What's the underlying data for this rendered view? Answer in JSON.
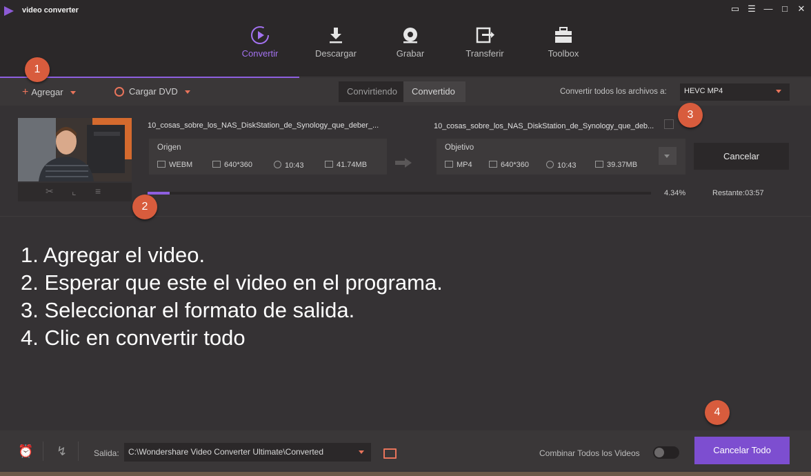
{
  "app": {
    "title": "video converter"
  },
  "nav": [
    {
      "label": "Convertir",
      "icon": "convert-icon",
      "active": true
    },
    {
      "label": "Descargar",
      "icon": "download-icon"
    },
    {
      "label": "Grabar",
      "icon": "burn-icon"
    },
    {
      "label": "Transferir",
      "icon": "transfer-icon"
    },
    {
      "label": "Toolbox",
      "icon": "toolbox-icon"
    }
  ],
  "toolbar": {
    "add_label": "Agregar",
    "dvd_label": "Cargar DVD",
    "tab_converting": "Convirtiendo",
    "tab_converted": "Convertido",
    "convert_all_label": "Convertir todos los archivos a:",
    "format": "HEVC MP4"
  },
  "file": {
    "source_name": "10_cosas_sobre_los_NAS_DiskStation_de_Synology_que_deber_...",
    "target_name": "10_cosas_sobre_los_NAS_DiskStation_de_Synology_que_deb...",
    "source": {
      "header": "Origen",
      "format": "WEBM",
      "resolution": "640*360",
      "duration": "10:43",
      "size": "41.74MB"
    },
    "target": {
      "header": "Objetivo",
      "format": "MP4",
      "resolution": "640*360",
      "duration": "10:43",
      "size": "39.37MB"
    },
    "cancel_label": "Cancelar",
    "progress_percent": 4.34,
    "progress_text": "4.34%",
    "remaining_text": "Restante:03:57"
  },
  "callouts": [
    "1",
    "2",
    "3",
    "4"
  ],
  "instructions": [
    "1. Agregar el video.",
    "2. Esperar que este el video en el programa.",
    "3. Seleccionar el formato de salida.",
    "4. Clic en convertir todo"
  ],
  "bottom": {
    "salida_label": "Salida:",
    "output_path": "C:\\Wondershare Video Converter Ultimate\\Converted",
    "combine_label": "Combinar Todos los Videos",
    "combine_on": false,
    "cancel_all_label": "Cancelar Todo"
  },
  "colors": {
    "accent": "#8e5fe0",
    "callout": "#d85c3d",
    "orange_icon": "#e8745b"
  }
}
